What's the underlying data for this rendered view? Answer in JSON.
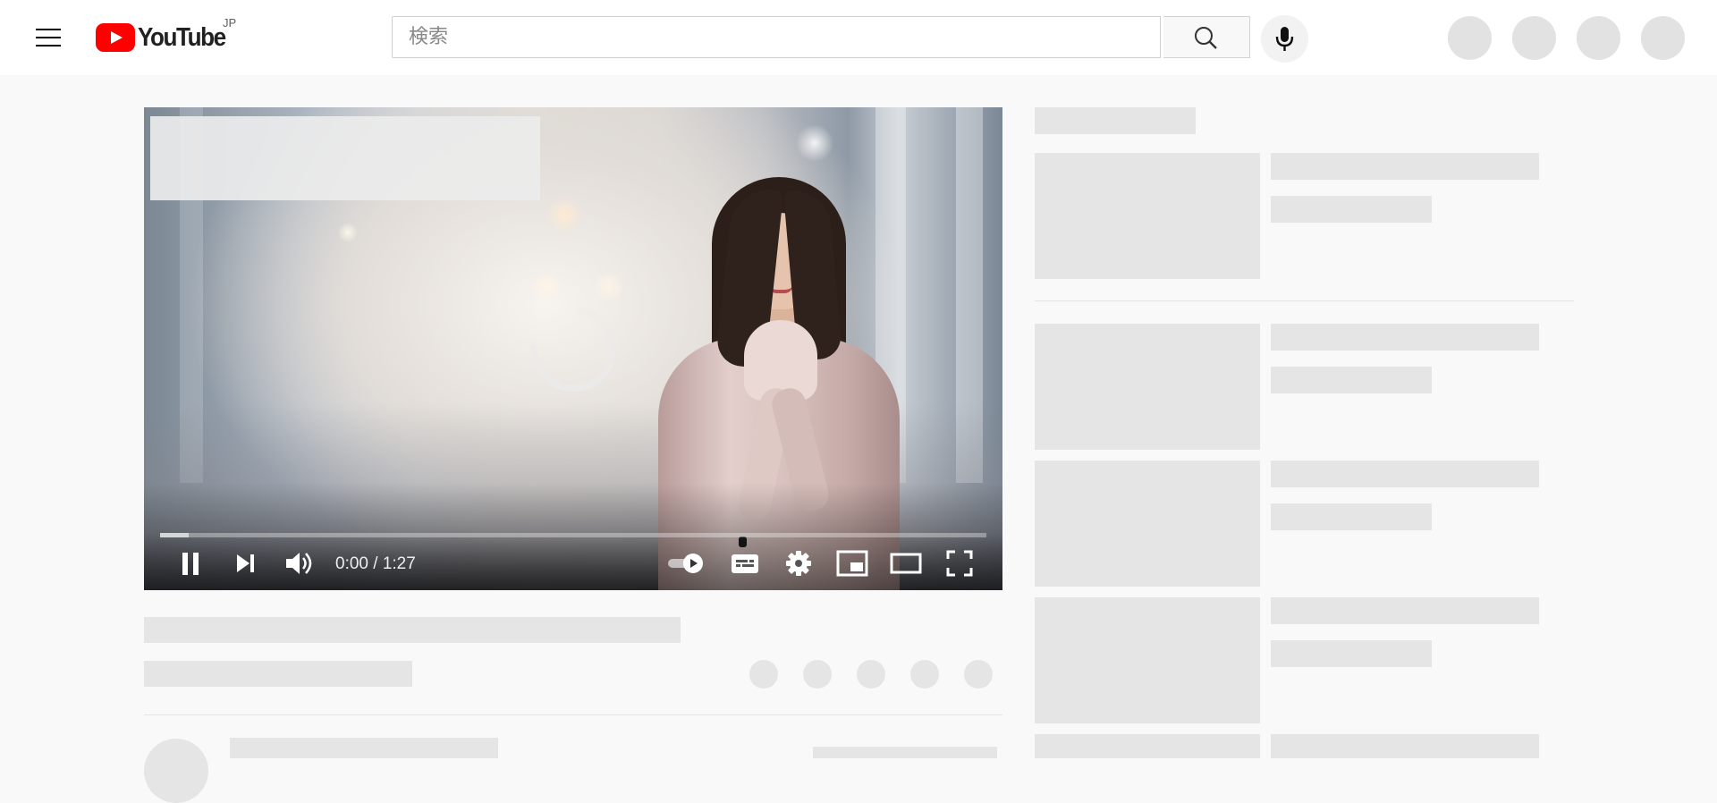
{
  "masthead": {
    "logo_text": "YouTube",
    "country_code": "JP",
    "search_placeholder": "検索",
    "search_value": ""
  },
  "player": {
    "state": "loading",
    "current_time": "0:00",
    "duration": "1:27",
    "time_display": "0:00 / 1:27",
    "buffered_fraction": 0.035,
    "autoplay_toggle": "on"
  },
  "icons": {
    "menu": "menu-icon",
    "search": "search-icon",
    "mic": "microphone-icon",
    "pause": "pause-icon",
    "next": "next-icon",
    "volume": "volume-icon",
    "autoplay": "autoplay-toggle-icon",
    "subtitles": "subtitles-icon",
    "settings": "gear-icon",
    "miniplayer": "miniplayer-icon",
    "theater": "theater-mode-icon",
    "fullscreen": "fullscreen-icon"
  },
  "colors": {
    "brand_red": "#ff0000",
    "page_bg": "#f9f9f9",
    "skeleton": "#e5e5e5"
  }
}
